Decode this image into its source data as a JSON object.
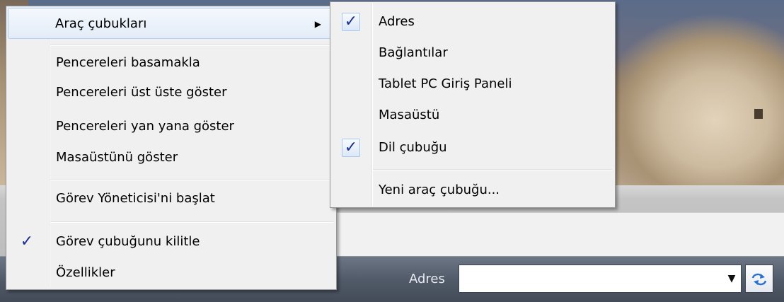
{
  "context_menu": {
    "items": [
      {
        "label": "Araç çubukları",
        "submenu": true
      },
      {
        "label": "Pencereleri basamakla"
      },
      {
        "label": "Pencereleri üst üste göster"
      },
      {
        "label": "Pencereleri yan yana göster"
      },
      {
        "label": "Masaüstünü göster"
      },
      {
        "label": "Görev Yöneticisi'ni başlat"
      },
      {
        "label": "Görev çubuğunu kilitle",
        "checked": true
      },
      {
        "label": "Özellikler"
      }
    ]
  },
  "toolbars_submenu": {
    "items": [
      {
        "label": "Adres",
        "checked": true
      },
      {
        "label": "Bağlantılar"
      },
      {
        "label": "Tablet PC Giriş Paneli"
      },
      {
        "label": "Masaüstü"
      },
      {
        "label": "Dil çubuğu",
        "checked": true
      },
      {
        "label": "Yeni araç çubuğu..."
      }
    ]
  },
  "taskbar": {
    "address_label": "Adres",
    "address_value": ""
  },
  "icons": {
    "check": "checkmark-icon",
    "submenu_arrow": "chevron-right-icon",
    "dropdown": "chevron-down-icon",
    "go": "refresh-go-icon"
  },
  "colors": {
    "check": "#1c2f8c",
    "menu_bg": "#f0f0f0",
    "hover_border": "#aecff7"
  }
}
